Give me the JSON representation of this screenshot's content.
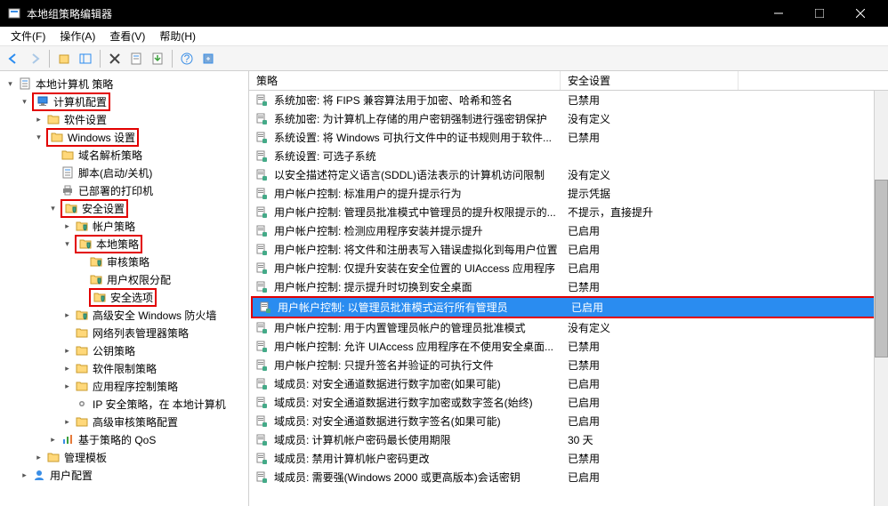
{
  "window": {
    "title": "本地组策略编辑器"
  },
  "menu": {
    "file": "文件(F)",
    "action": "操作(A)",
    "view": "查看(V)",
    "help": "帮助(H)"
  },
  "tree": {
    "root": "本地计算机 策略",
    "computer": "计算机配置",
    "software": "软件设置",
    "windows": "Windows 设置",
    "dns": "域名解析策略",
    "scripts": "脚本(启动/关机)",
    "printers": "已部署的打印机",
    "security": "安全设置",
    "account": "帐户策略",
    "local": "本地策略",
    "audit": "审核策略",
    "userrights": "用户权限分配",
    "secoptions": "安全选项",
    "firewall": "高级安全 Windows 防火墙",
    "netlist": "网络列表管理器策略",
    "pubkey": "公钥策略",
    "software_restrict": "软件限制策略",
    "appctrl": "应用程序控制策略",
    "ipsec": "IP 安全策略，在 本地计算机",
    "advaudit": "高级审核策略配置",
    "qos": "基于策略的 QoS",
    "admin_templates": "管理模板",
    "user": "用户配置"
  },
  "list": {
    "headers": {
      "policy": "策略",
      "setting": "安全设置"
    },
    "rows": [
      {
        "name": "系统加密: 将 FIPS 兼容算法用于加密、哈希和签名",
        "value": "已禁用"
      },
      {
        "name": "系统加密: 为计算机上存储的用户密钥强制进行强密钥保护",
        "value": "没有定义"
      },
      {
        "name": "系统设置: 将 Windows 可执行文件中的证书规则用于软件...",
        "value": "已禁用"
      },
      {
        "name": "系统设置: 可选子系统",
        "value": ""
      },
      {
        "name": "以安全描述符定义语言(SDDL)语法表示的计算机访问限制",
        "value": "没有定义"
      },
      {
        "name": "用户帐户控制: 标准用户的提升提示行为",
        "value": "提示凭据"
      },
      {
        "name": "用户帐户控制: 管理员批准模式中管理员的提升权限提示的...",
        "value": "不提示，直接提升"
      },
      {
        "name": "用户帐户控制: 检测应用程序安装并提示提升",
        "value": "已启用"
      },
      {
        "name": "用户帐户控制: 将文件和注册表写入错误虚拟化到每用户位置",
        "value": "已启用"
      },
      {
        "name": "用户帐户控制: 仅提升安装在安全位置的 UIAccess 应用程序",
        "value": "已启用"
      },
      {
        "name": "用户帐户控制: 提示提升时切换到安全桌面",
        "value": "已禁用"
      },
      {
        "name": "用户帐户控制: 以管理员批准模式运行所有管理员",
        "value": "已启用",
        "selected": true
      },
      {
        "name": "用户帐户控制: 用于内置管理员帐户的管理员批准模式",
        "value": "没有定义"
      },
      {
        "name": "用户帐户控制: 允许 UIAccess 应用程序在不使用安全桌面...",
        "value": "已禁用"
      },
      {
        "name": "用户帐户控制: 只提升签名并验证的可执行文件",
        "value": "已禁用"
      },
      {
        "name": "域成员: 对安全通道数据进行数字加密(如果可能)",
        "value": "已启用"
      },
      {
        "name": "域成员: 对安全通道数据进行数字加密或数字签名(始终)",
        "value": "已启用"
      },
      {
        "name": "域成员: 对安全通道数据进行数字签名(如果可能)",
        "value": "已启用"
      },
      {
        "name": "域成员: 计算机帐户密码最长使用期限",
        "value": "30 天"
      },
      {
        "name": "域成员: 禁用计算机帐户密码更改",
        "value": "已禁用"
      },
      {
        "name": "域成员: 需要强(Windows 2000 或更高版本)会话密钥",
        "value": "已启用"
      }
    ]
  }
}
